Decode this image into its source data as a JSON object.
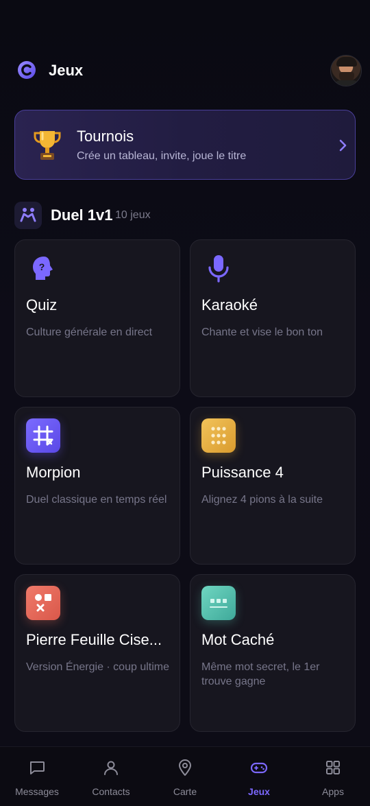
{
  "header": {
    "title": "Jeux",
    "logo_icon": "logo-c-icon",
    "avatar": "user-avatar"
  },
  "tournament": {
    "title": "Tournois",
    "subtitle": "Crée un tableau, invite, joue le titre",
    "icon": "trophy-icon"
  },
  "section": {
    "title": "Duel 1v1",
    "count": "10 jeux",
    "icon": "duel-icon"
  },
  "games": [
    {
      "title": "Quiz",
      "description": "Culture générale en direct",
      "icon": "head-question-icon"
    },
    {
      "title": "Karaoké",
      "description": "Chante et vise le bon ton",
      "icon": "microphone-icon"
    },
    {
      "title": "Morpion",
      "description": "Duel classique en temps réel",
      "icon": "tic-tac-toe-icon"
    },
    {
      "title": "Puissance 4",
      "description": "Alignez 4 pions à la suite",
      "icon": "connect-four-icon"
    },
    {
      "title": "Pierre Feuille Cise...",
      "description": "Version Énergie · coup ultime",
      "icon": "rock-paper-scissors-icon"
    },
    {
      "title": "Mot Caché",
      "description": "Même mot secret, le 1er trouve gagne",
      "icon": "hidden-word-icon"
    }
  ],
  "nav": [
    {
      "label": "Messages",
      "icon": "chat-icon",
      "active": false
    },
    {
      "label": "Contacts",
      "icon": "person-icon",
      "active": false
    },
    {
      "label": "Carte",
      "icon": "map-pin-icon",
      "active": false
    },
    {
      "label": "Jeux",
      "icon": "gamepad-icon",
      "active": true
    },
    {
      "label": "Apps",
      "icon": "grid-icon",
      "active": false
    }
  ],
  "colors": {
    "accent": "#7c68ff",
    "background": "#0b0b13",
    "card": "#17161f"
  }
}
